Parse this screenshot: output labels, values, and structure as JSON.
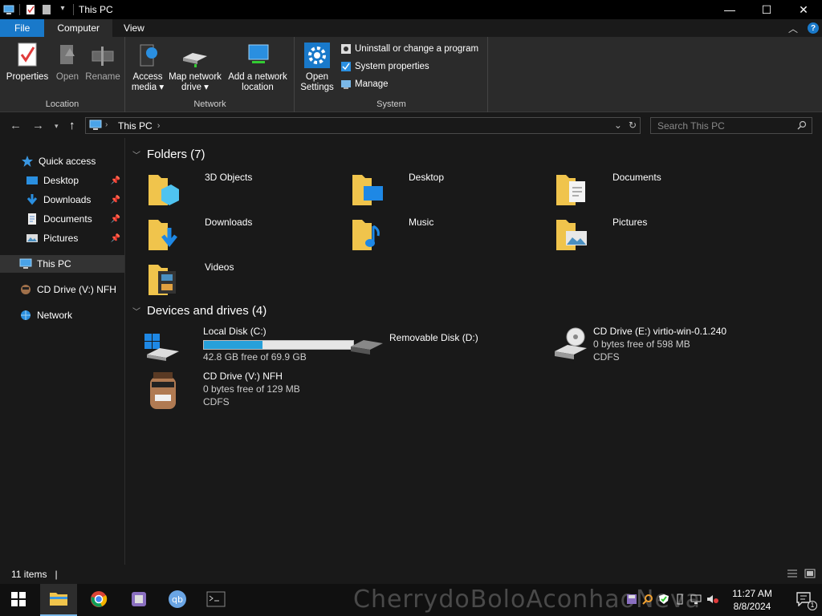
{
  "window": {
    "title": "This PC",
    "controls": {
      "minimize": "—",
      "maximize": "☐",
      "close": "✕"
    }
  },
  "ribbon": {
    "tabs": [
      {
        "label": "File"
      },
      {
        "label": "Computer"
      },
      {
        "label": "View"
      }
    ],
    "groups": {
      "location": {
        "label": "Location",
        "buttons": [
          {
            "label": "Properties",
            "icon": "properties-icon"
          },
          {
            "label": "Open",
            "icon": "open-icon"
          },
          {
            "label": "Rename",
            "icon": "rename-icon"
          }
        ]
      },
      "network": {
        "label": "Network",
        "buttons": [
          {
            "label_line1": "Access",
            "label_line2": "media ▾",
            "icon": "access-media-icon"
          },
          {
            "label_line1": "Map network",
            "label_line2": "drive ▾",
            "icon": "map-drive-icon"
          },
          {
            "label_line1": "Add a network",
            "label_line2": "location",
            "icon": "add-network-location-icon"
          }
        ]
      },
      "system": {
        "label": "System",
        "open_settings_line1": "Open",
        "open_settings_line2": "Settings",
        "items": [
          {
            "label": "Uninstall or change a program",
            "icon": "uninstall-icon"
          },
          {
            "label": "System properties",
            "icon": "system-properties-icon"
          },
          {
            "label": "Manage",
            "icon": "manage-icon"
          }
        ]
      }
    }
  },
  "address": {
    "crumb": "This PC",
    "search_placeholder": "Search This PC"
  },
  "navpane": {
    "quick_access": "Quick access",
    "pinned": [
      {
        "label": "Desktop"
      },
      {
        "label": "Downloads"
      },
      {
        "label": "Documents"
      },
      {
        "label": "Pictures"
      }
    ],
    "this_pc": "This PC",
    "cd_drive": "CD Drive (V:) NFH",
    "network": "Network"
  },
  "content": {
    "folders_header": "Folders (7)",
    "folders": [
      {
        "name": "3D Objects"
      },
      {
        "name": "Desktop"
      },
      {
        "name": "Documents"
      },
      {
        "name": "Downloads"
      },
      {
        "name": "Music"
      },
      {
        "name": "Pictures"
      },
      {
        "name": "Videos"
      }
    ],
    "drives_header": "Devices and drives (4)",
    "drives": [
      {
        "name": "Local Disk (C:)",
        "free": "42.8 GB free of 69.9 GB",
        "used_fraction": 0.39
      },
      {
        "name": "Removable Disk (D:)"
      },
      {
        "name": "CD Drive (E:) virtio-win-0.1.240",
        "free": "0 bytes free of 598 MB",
        "fs": "CDFS"
      },
      {
        "name": "CD Drive (V:) NFH",
        "free": "0 bytes free of 129 MB",
        "fs": "CDFS"
      }
    ]
  },
  "status": {
    "items": "11 items",
    "pipe": "|"
  },
  "taskbar": {
    "watermark": "CherrydoBoloAconhaoNeva",
    "time": "11:27 AM",
    "date": "8/8/2024",
    "notif_count": "1"
  },
  "colors": {
    "accent": "#1979ca",
    "progress": "#26a0da",
    "background": "#191919",
    "ribbon": "#2b2b2b"
  }
}
